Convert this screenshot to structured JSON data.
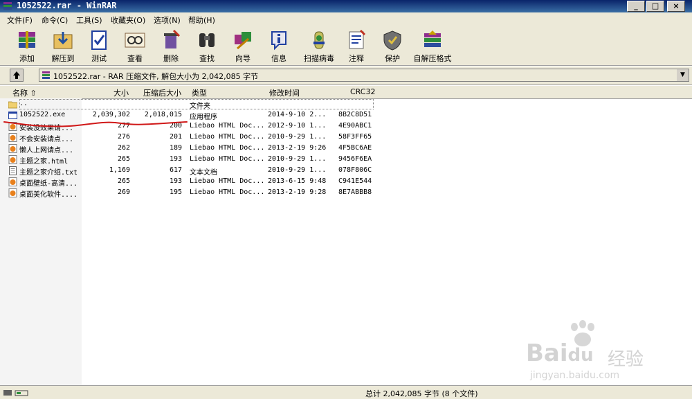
{
  "window": {
    "title": "1052522.rar - WinRAR"
  },
  "menu": [
    "文件(F)",
    "命令(C)",
    "工具(S)",
    "收藏夹(O)",
    "选项(N)",
    "帮助(H)"
  ],
  "toolbar": [
    {
      "label": "添加",
      "icon": "add-icon"
    },
    {
      "label": "解压到",
      "icon": "extract-to-icon"
    },
    {
      "label": "测试",
      "icon": "test-icon"
    },
    {
      "label": "查看",
      "icon": "view-icon"
    },
    {
      "label": "删除",
      "icon": "delete-icon"
    },
    {
      "label": "查找",
      "icon": "find-icon"
    },
    {
      "label": "向导",
      "icon": "wizard-icon"
    },
    {
      "label": "信息",
      "icon": "info-icon"
    },
    {
      "label": "扫描病毒",
      "icon": "virus-scan-icon"
    },
    {
      "label": "注释",
      "icon": "comment-icon"
    },
    {
      "label": "保护",
      "icon": "protect-icon"
    },
    {
      "label": "自解压格式",
      "icon": "sfx-icon"
    }
  ],
  "address": {
    "path": "1052522.rar - RAR 压缩文件, 解包大小为 2,042,085 字节"
  },
  "columns": {
    "name": "名称",
    "size": "大小",
    "packed": "压缩后大小",
    "type": "类型",
    "modified": "修改时间",
    "crc": "CRC32"
  },
  "files": [
    {
      "name": "..",
      "size": "",
      "packed": "",
      "type": "文件夹",
      "modified": "",
      "crc": "",
      "icon": "folder-icon"
    },
    {
      "name": "1052522.exe",
      "size": "2,039,302",
      "packed": "2,018,015",
      "type": "应用程序",
      "modified": "2014-9-10 2...",
      "crc": "8B2C8D51",
      "icon": "exe-icon"
    },
    {
      "name": "安装没效果请...",
      "size": "277",
      "packed": "200",
      "type": "Liebao HTML Doc...",
      "modified": "2012-9-10 1...",
      "crc": "4E90ABC1",
      "icon": "html-icon"
    },
    {
      "name": "不会安装请点...",
      "size": "276",
      "packed": "201",
      "type": "Liebao HTML Doc...",
      "modified": "2010-9-29 1...",
      "crc": "58F3FF65",
      "icon": "html-icon"
    },
    {
      "name": "懒人上网请点...",
      "size": "262",
      "packed": "189",
      "type": "Liebao HTML Doc...",
      "modified": "2013-2-19 9:26",
      "crc": "4F5BC6AE",
      "icon": "html-icon"
    },
    {
      "name": "主题之家.html",
      "size": "265",
      "packed": "193",
      "type": "Liebao HTML Doc...",
      "modified": "2010-9-29 1...",
      "crc": "9456F6EA",
      "icon": "html-icon"
    },
    {
      "name": "主题之家介绍.txt",
      "size": "1,169",
      "packed": "617",
      "type": "文本文档",
      "modified": "2010-9-29 1...",
      "crc": "078F806C",
      "icon": "txt-icon"
    },
    {
      "name": "桌面壁纸-高清...",
      "size": "265",
      "packed": "193",
      "type": "Liebao HTML Doc...",
      "modified": "2013-6-15 9:48",
      "crc": "C941E544",
      "icon": "html-icon"
    },
    {
      "name": "桌面美化软件....",
      "size": "269",
      "packed": "195",
      "type": "Liebao HTML Doc...",
      "modified": "2013-2-19 9:28",
      "crc": "8E7ABBB8",
      "icon": "html-icon"
    }
  ],
  "status": {
    "text": "总计 2,042,085 字节 (8 个文件)"
  },
  "watermark": {
    "brand": "Bai",
    "brand2": "du",
    "cn": "经验",
    "url": "jingyan.baidu.com"
  }
}
